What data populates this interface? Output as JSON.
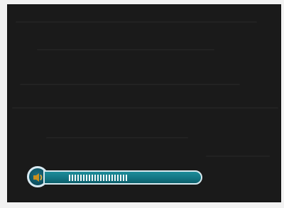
{
  "screen": {
    "background_color": "#1a1a1a"
  },
  "volume_overlay": {
    "icon": "speaker-icon",
    "level_ticks": 21,
    "accent_color": "#137684",
    "border_color": "#d7e9ef",
    "tick_color": "#f3f7f8"
  }
}
